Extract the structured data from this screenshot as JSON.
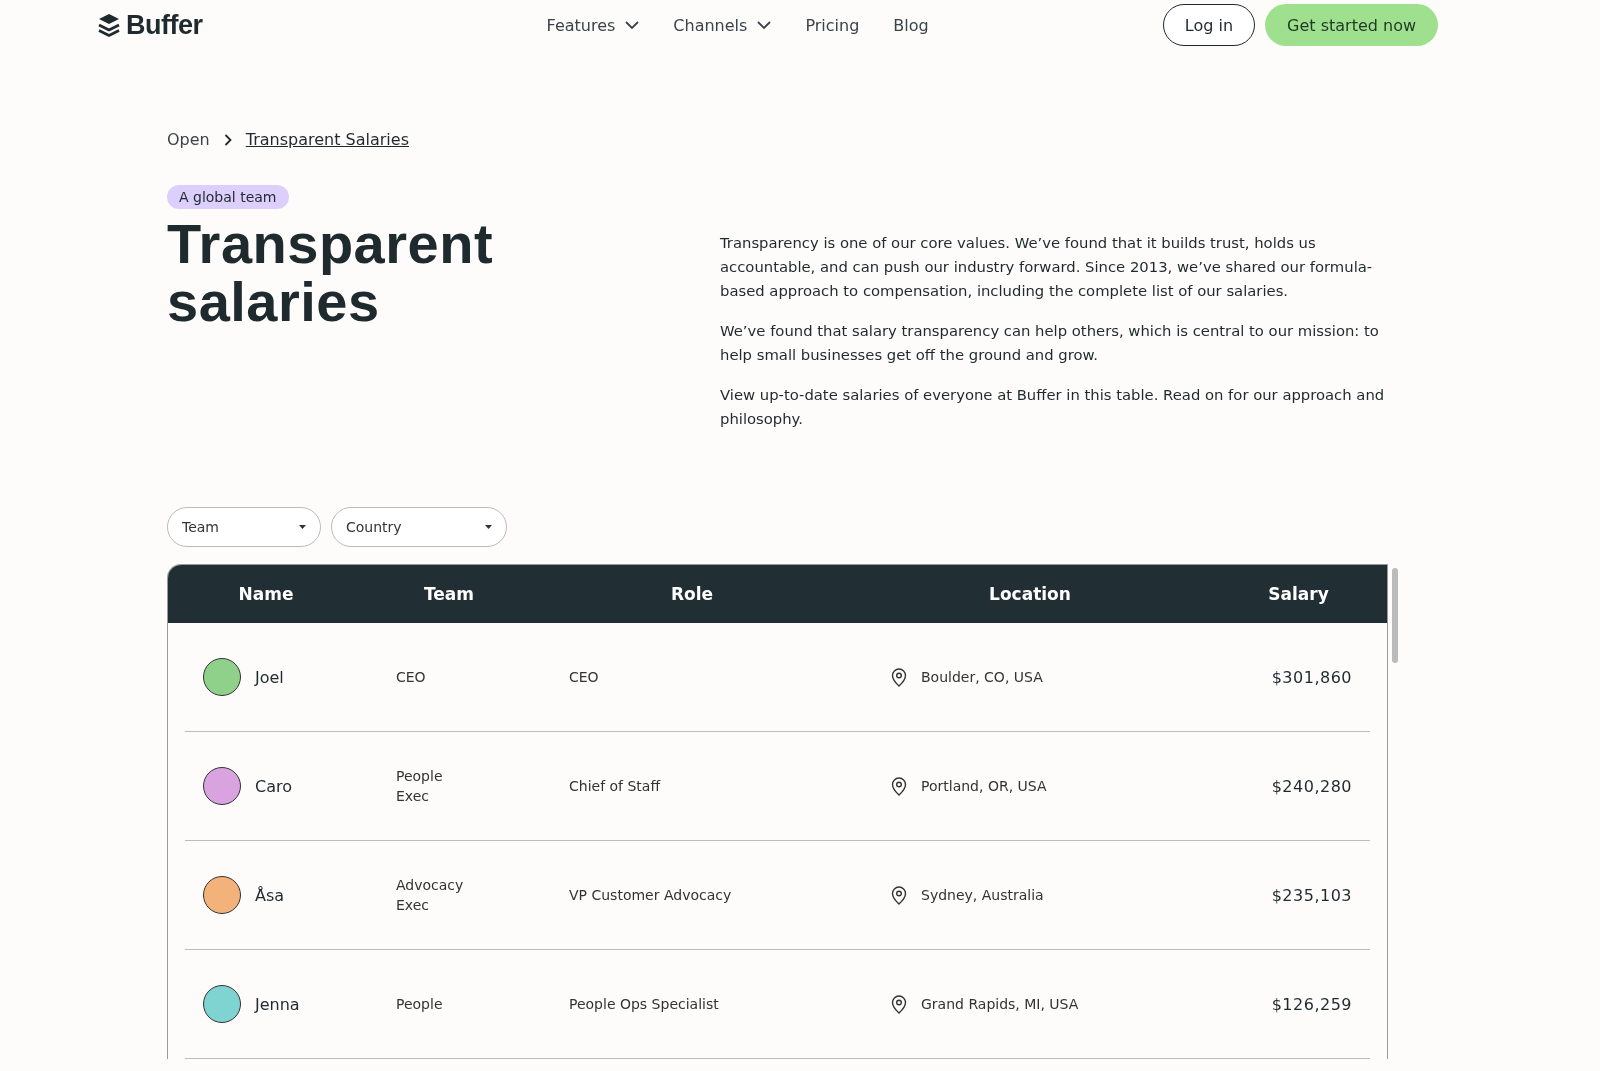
{
  "nav": {
    "logo": "Buffer",
    "links": [
      {
        "label": "Features",
        "dropdown": true
      },
      {
        "label": "Channels",
        "dropdown": true
      },
      {
        "label": "Pricing",
        "dropdown": false
      },
      {
        "label": "Blog",
        "dropdown": false
      }
    ],
    "login": "Log in",
    "cta": "Get started now"
  },
  "breadcrumb": {
    "parent": "Open",
    "current": "Transparent Salaries"
  },
  "badge": "A global team",
  "title": "Transparent salaries",
  "paragraphs": [
    "Transparency is one of our core values. We’ve found that it builds trust, holds us accountable, and can push our industry forward. Since 2013, we’ve shared our formula-based approach to compensation, including the complete list of our salaries.",
    "We’ve found that salary transparency can help others, which is central to our mission: to help small businesses get off the ground and grow.",
    "View up-to-date salaries of everyone at Buffer in this table. Read on for our approach and philosophy."
  ],
  "filters": [
    {
      "label": "Team"
    },
    {
      "label": "Country"
    }
  ],
  "table": {
    "columns": [
      "Name",
      "Team",
      "Role",
      "Location",
      "Salary"
    ],
    "rows": [
      {
        "name": "Joel",
        "color": "#8fd18a",
        "team": "CEO",
        "role": "CEO",
        "location": "Boulder, CO, USA",
        "salary": "$301,860"
      },
      {
        "name": "Caro",
        "color": "#d9a3e0",
        "team": "People Exec",
        "role": "Chief of Staff",
        "location": "Portland, OR, USA",
        "salary": "$240,280"
      },
      {
        "name": "Åsa",
        "color": "#f2b27a",
        "team": "Advocacy Exec",
        "role": "VP Customer Advocacy",
        "location": "Sydney, Australia",
        "salary": "$235,103"
      },
      {
        "name": "Jenna",
        "color": "#7fd3d0",
        "team": "People",
        "role": "People Ops Specialist",
        "location": "Grand Rapids, MI, USA",
        "salary": "$126,259"
      }
    ]
  }
}
